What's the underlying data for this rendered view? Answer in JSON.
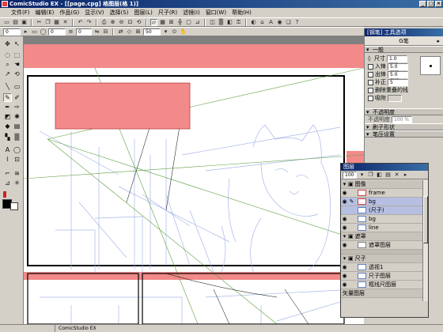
{
  "window": {
    "title": "ComicStudio EX - [[page.cpg] 格图层(格 1)]"
  },
  "menu": [
    "文件(F)",
    "编辑(E)",
    "作品(G)",
    "显示(V)",
    "选择(S)",
    "图层(L)",
    "尺子(R)",
    "滤镜(I)",
    "窗口(W)",
    "帮助(H)"
  ],
  "option_bar": {
    "value1": "0",
    "value2": "0",
    "value3": "0",
    "value4": "50"
  },
  "tool_options": {
    "title": "[钢笔] 工具选项",
    "tool_name": "G笔",
    "sections": {
      "general": "一般",
      "opacity": "不透明度",
      "brush": "刷子形状",
      "pressure": "笔压设置"
    },
    "size": {
      "label": "尺寸",
      "value": "1.0 mm"
    },
    "in": {
      "label": "入锋",
      "value": "5.0 mm"
    },
    "out": {
      "label": "出锋",
      "value": "5.0 mm"
    },
    "correction": {
      "label": "补正",
      "value": "5"
    },
    "delete_overlap": {
      "label": "删除重叠的线"
    },
    "snap": {
      "label": "吸附"
    },
    "opacity_row": {
      "label": "不透明度",
      "value": "100 %"
    }
  },
  "layers": {
    "title": "图层",
    "opacity": "100",
    "folders": {
      "image": "图像",
      "mask": "遮罩",
      "ruler": "尺子"
    },
    "items": {
      "frame": "frame",
      "bg_selected": "bg",
      "ruler_sub": "(尺子)",
      "bg": "bg",
      "line": "line",
      "mask_layer": "遮罩图层",
      "perspective": "透视1",
      "ruler_layer": "尺子图层",
      "frame_ruler": "框线尺图层",
      "vector": "矢量图层"
    }
  },
  "statusbar": {
    "text": "ComicStudio EX"
  },
  "colors": {
    "accent": "#0a246a",
    "mask": "#f28a8a",
    "sketch": "#a8b8e8",
    "guide": "#60a040"
  }
}
